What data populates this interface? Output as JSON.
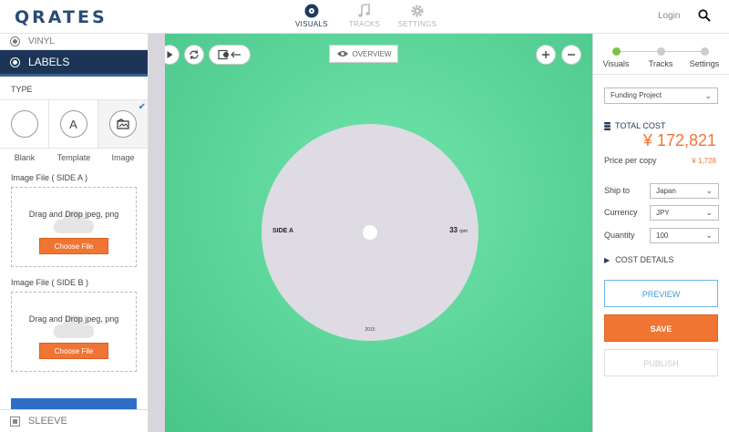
{
  "header": {
    "logo": "QRATES",
    "nav": [
      {
        "label": "VISUALS",
        "active": true,
        "icon": "record-icon"
      },
      {
        "label": "TRACKS",
        "active": false,
        "icon": "music-note-icon"
      },
      {
        "label": "SETTINGS",
        "active": false,
        "icon": "gear-icon"
      }
    ],
    "login": "Login"
  },
  "left": {
    "vinyl": "VINYL",
    "labels": "LABELS",
    "type_title": "TYPE",
    "types": [
      {
        "label": "Blank"
      },
      {
        "label": "Template",
        "glyph": "A"
      },
      {
        "label": "Image",
        "selected": true
      }
    ],
    "side_a": {
      "title": "Image File ( SIDE A )",
      "drop_text": "Drag and Drop jpeg, png",
      "button": "Choose File"
    },
    "side_b": {
      "title": "Image File ( SIDE B )",
      "drop_text": "Drag and Drop jpeg, png",
      "button": "Choose File"
    },
    "sleeve": "SLEEVE"
  },
  "canvas": {
    "overview": "OVERVIEW",
    "label": {
      "side": "SIDE A",
      "rpm": "33",
      "rpm_unit": "rpm",
      "year": "2015"
    },
    "colors": {
      "vinyl": "#5fd79c",
      "label": "#dedbe3"
    }
  },
  "right": {
    "steps": [
      {
        "label": "Visuals",
        "done": true
      },
      {
        "label": "Tracks",
        "done": false
      },
      {
        "label": "Settings",
        "done": false
      }
    ],
    "project_type": "Funding Project",
    "total_cost_label": "TOTAL COST",
    "total_cost": "¥ 172,821",
    "price_per_copy_label": "Price per copy",
    "price_per_copy": "¥ 1,728",
    "ship_to_label": "Ship to",
    "ship_to": "Japan",
    "currency_label": "Currency",
    "currency": "JPY",
    "quantity_label": "Quantity",
    "quantity": "100",
    "cost_details": "COST DETAILS",
    "preview": "PREVIEW",
    "save": "SAVE",
    "publish": "PUBLISH"
  }
}
